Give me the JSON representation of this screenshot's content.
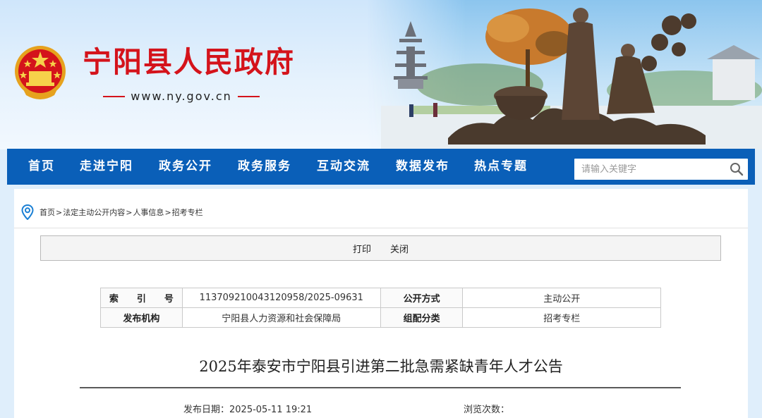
{
  "header": {
    "site_title": "宁阳县人民政府",
    "site_url": "www.ny.gov.cn",
    "brand_color": "#d4131b"
  },
  "nav": {
    "items": [
      "首页",
      "走进宁阳",
      "政务公开",
      "政务服务",
      "互动交流",
      "数据发布",
      "热点专题"
    ],
    "background": "#0a5fb8",
    "search_placeholder": "请输入关键字"
  },
  "breadcrumb": [
    "首页",
    "法定主动公开内容",
    "人事信息",
    "招考专栏"
  ],
  "breadcrumb_separator": ">",
  "toolbar": {
    "print_label": "打印",
    "close_label": "关闭"
  },
  "meta": {
    "index_label": "索　　引　　号",
    "index_value": "113709210043120958/2025-09631",
    "disclosure_label": "公开方式",
    "disclosure_value": "主动公开",
    "publisher_label": "发布机构",
    "publisher_value": "宁阳县人力资源和社会保障局",
    "category_label": "组配分类",
    "category_value": "招考专栏"
  },
  "article": {
    "title": "2025年泰安市宁阳县引进第二批急需紧缺青年人才公告",
    "date_label": "发布日期：",
    "date_value": "2025-05-11 19:21",
    "views_label": "浏览次数："
  }
}
